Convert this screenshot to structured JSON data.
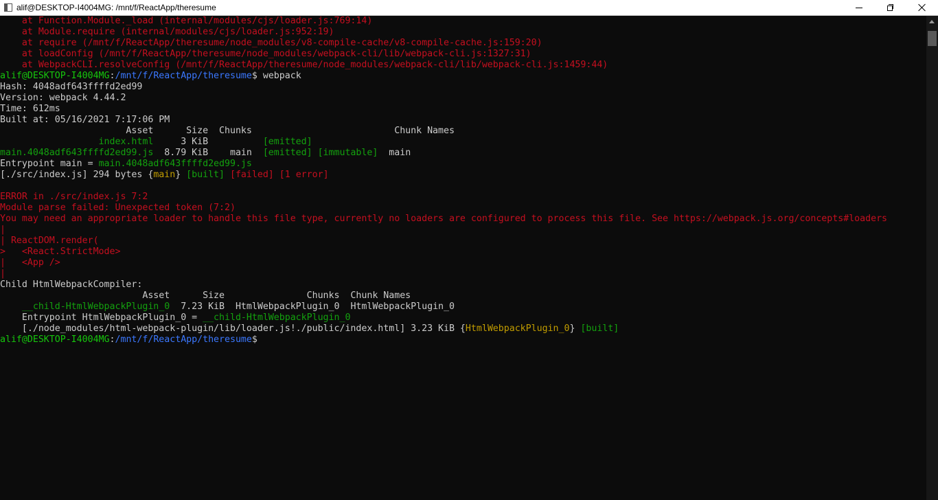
{
  "window": {
    "title": "alif@DESKTOP-I4004MG: /mnt/f/ReactApp/theresume",
    "icon": "terminal-icon",
    "controls": [
      "minimize-icon",
      "maximize-icon",
      "close-icon"
    ]
  },
  "colors": {
    "background": "#0c0c0c",
    "text": "#cccccc",
    "error_red": "#c50f1f",
    "green": "#13a10e",
    "prompt_green": "#16c60c",
    "prompt_blue": "#3b78ff",
    "yellow": "#c19c00"
  },
  "terminal": {
    "lines": [
      [
        {
          "t": "    at Function.Module._load (internal/modules/cjs/loader.js:769:14)",
          "c": "r"
        }
      ],
      [
        {
          "t": "    at Module.require (internal/modules/cjs/loader.js:952:19)",
          "c": "r"
        }
      ],
      [
        {
          "t": "    at require (/mnt/f/ReactApp/theresume/node_modules/v8-compile-cache/v8-compile-cache.js:159:20)",
          "c": "r"
        }
      ],
      [
        {
          "t": "    at loadConfig (/mnt/f/ReactApp/theresume/node_modules/webpack-cli/lib/webpack-cli.js:1327:31)",
          "c": "r"
        }
      ],
      [
        {
          "t": "    at WebpackCLI.resolveConfig (/mnt/f/ReactApp/theresume/node_modules/webpack-cli/lib/webpack-cli.js:1459:44)",
          "c": "r"
        }
      ],
      [
        {
          "t": "alif@DESKTOP-I4004MG",
          "c": "pg"
        },
        {
          "t": ":",
          "c": "w"
        },
        {
          "t": "/mnt/f/ReactApp/theresume",
          "c": "pb"
        },
        {
          "t": "$ webpack",
          "c": "w"
        }
      ],
      [
        {
          "t": "Hash: 4048adf643ffffd2ed99",
          "c": "w"
        }
      ],
      [
        {
          "t": "Version: webpack 4.44.2",
          "c": "w"
        }
      ],
      [
        {
          "t": "Time: 612ms",
          "c": "w"
        }
      ],
      [
        {
          "t": "Built at: 05/16/2021 7:17:06 PM",
          "c": "w"
        }
      ],
      [
        {
          "t": "                       Asset      Size  Chunks                          Chunk Names",
          "c": "w"
        }
      ],
      [
        {
          "t": "                  index.html",
          "c": "g"
        },
        {
          "t": "     3 KiB          ",
          "c": "w"
        },
        {
          "t": "[emitted]",
          "c": "g"
        }
      ],
      [
        {
          "t": "main.4048adf643ffffd2ed99.js",
          "c": "g"
        },
        {
          "t": "  8.79 KiB    main  ",
          "c": "w"
        },
        {
          "t": "[emitted] [immutable]",
          "c": "g"
        },
        {
          "t": "  main",
          "c": "w"
        }
      ],
      [
        {
          "t": "Entrypoint main = ",
          "c": "w"
        },
        {
          "t": "main.4048adf643ffffd2ed99.js",
          "c": "g"
        }
      ],
      [
        {
          "t": "[./src/index.js] 294 bytes {",
          "c": "w"
        },
        {
          "t": "main",
          "c": "y"
        },
        {
          "t": "} ",
          "c": "w"
        },
        {
          "t": "[built]",
          "c": "g"
        },
        {
          "t": " ",
          "c": "w"
        },
        {
          "t": "[failed]",
          "c": "r"
        },
        {
          "t": " ",
          "c": "w"
        },
        {
          "t": "[1 error]",
          "c": "r"
        }
      ],
      [
        {
          "t": "",
          "c": "w"
        }
      ],
      [
        {
          "t": "ERROR in ./src/index.js 7:2",
          "c": "r"
        }
      ],
      [
        {
          "t": "Module parse failed: Unexpected token (7:2)",
          "c": "r"
        }
      ],
      [
        {
          "t": "You may need an appropriate loader to handle this file type, currently no loaders are configured to process this file. See https://webpack.js.org/concepts#loaders",
          "c": "r"
        }
      ],
      [
        {
          "t": "|",
          "c": "r"
        }
      ],
      [
        {
          "t": "| ReactDOM.render(",
          "c": "r"
        }
      ],
      [
        {
          "t": ">   <React.StrictMode>",
          "c": "r"
        }
      ],
      [
        {
          "t": "|   <App />",
          "c": "r"
        }
      ],
      [
        {
          "t": "|",
          "c": "r"
        }
      ],
      [
        {
          "t": "Child HtmlWebpackCompiler:",
          "c": "w"
        }
      ],
      [
        {
          "t": "                          Asset      Size               Chunks  Chunk Names",
          "c": "w"
        }
      ],
      [
        {
          "t": "    __child-HtmlWebpackPlugin_0",
          "c": "g"
        },
        {
          "t": "  7.23 KiB  HtmlWebpackPlugin_0  HtmlWebpackPlugin_0",
          "c": "w"
        }
      ],
      [
        {
          "t": "    Entrypoint HtmlWebpackPlugin_0 = ",
          "c": "w"
        },
        {
          "t": "__child-HtmlWebpackPlugin_0",
          "c": "g"
        }
      ],
      [
        {
          "t": "    [./node_modules/html-webpack-plugin/lib/loader.js!./public/index.html] 3.23 KiB {",
          "c": "w"
        },
        {
          "t": "HtmlWebpackPlugin_0",
          "c": "y"
        },
        {
          "t": "} ",
          "c": "w"
        },
        {
          "t": "[built]",
          "c": "g"
        }
      ],
      [
        {
          "t": "alif@DESKTOP-I4004MG",
          "c": "pg"
        },
        {
          "t": ":",
          "c": "w"
        },
        {
          "t": "/mnt/f/ReactApp/theresume",
          "c": "pb"
        },
        {
          "t": "$",
          "c": "w"
        }
      ]
    ]
  }
}
